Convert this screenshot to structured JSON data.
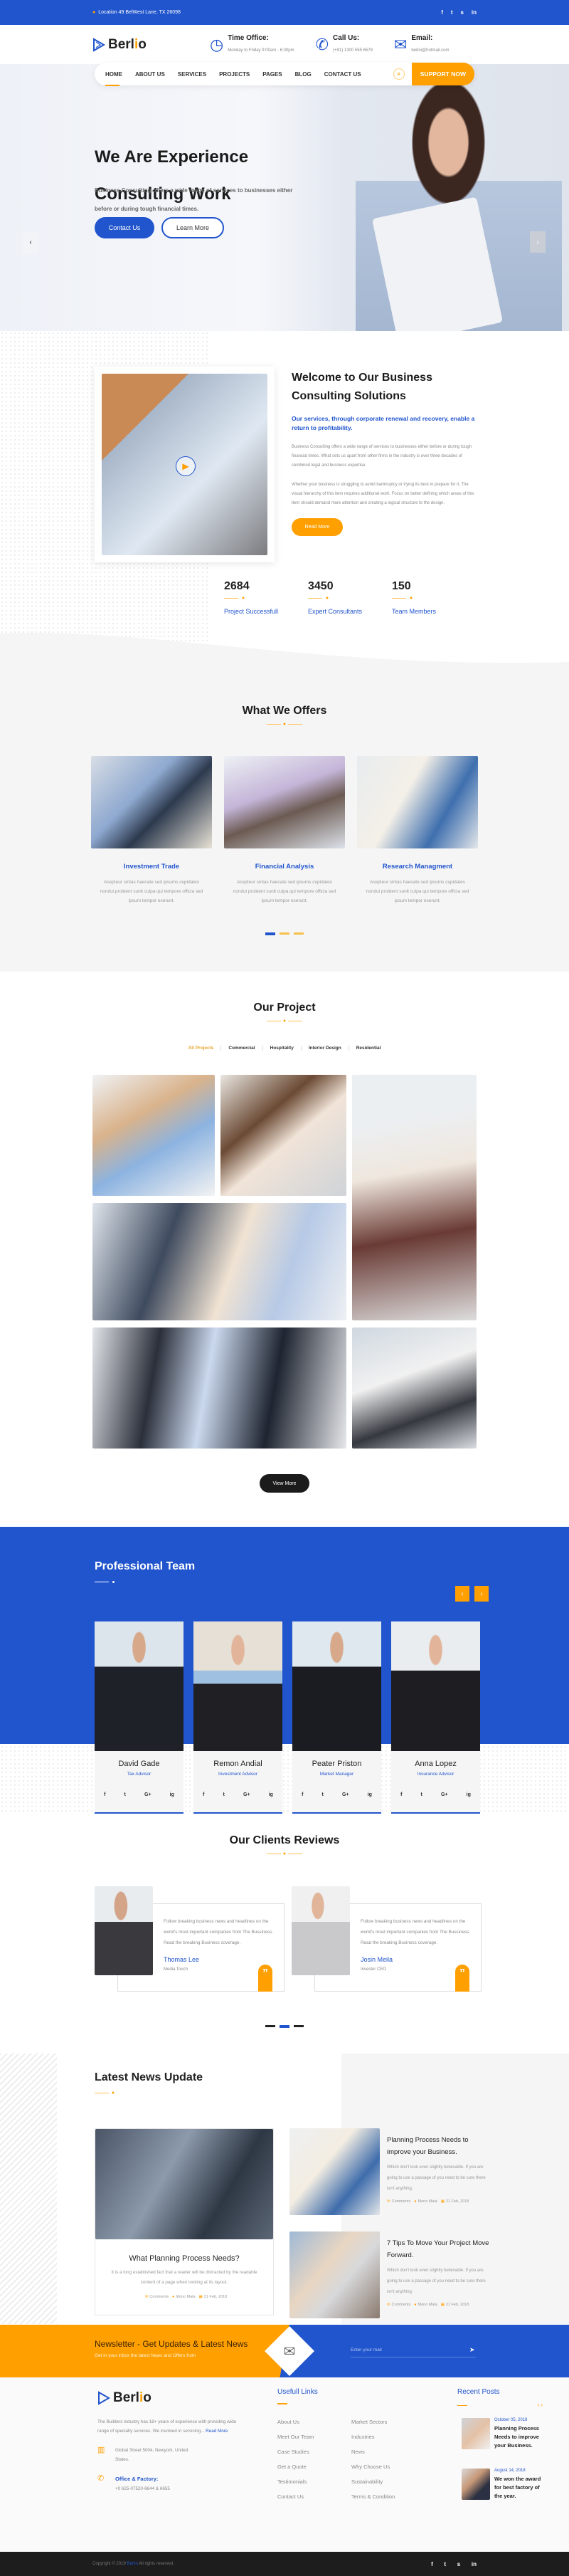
{
  "topbar": {
    "location": "Location 49 BelWest Lane, TX 26098",
    "social": [
      "f",
      "t",
      "s",
      "in"
    ]
  },
  "brand": {
    "name_a": "Berl",
    "name_i": "i",
    "name_b": "o"
  },
  "header": {
    "time": {
      "title": "Time Office:",
      "text": "Monday to Friday 9:00am - 6:00pm"
    },
    "call": {
      "title": "Call Us:",
      "text": "(+91) 1300 555 6578"
    },
    "email": {
      "title": "Email:",
      "text": "berlio@hotmail.com"
    }
  },
  "nav": {
    "items": [
      "HOME",
      "ABOUT US",
      "SERVICES",
      "PROJECTS",
      "PAGES",
      "BLOG",
      "CONTACT US"
    ],
    "active": "HOME",
    "support": "SUPPORT NOW"
  },
  "hero": {
    "title_line1": "We Are Experience",
    "title_line2": "Consulting Work",
    "text": "Business Consulting offers a wide range of services to businesses either before or during tough financial times.",
    "contact": "Contact Us",
    "learn": "Learn More"
  },
  "about": {
    "title": "Welcome to Our Business Consulting Solutions",
    "lead": "Our services, through corporate renewal and recovery, enable a return to profitability.",
    "p1": "Business Consulting offers a wide range of services to businesses either before or during tough financial times. What sets us apart from other firms in the industry is over three decades of combined legal and business expertise.",
    "p2": "Whether your business is struggling to avoid bankruptcy or trying its best to prepare for it, The visual hierarchy of this item requires additional work. Focus on better defining which areas of this item should demand more attention and creating a logical structure to the design.",
    "read_more": "Read More",
    "stats": [
      {
        "value": "2684",
        "label": "Project Successfull"
      },
      {
        "value": "3450",
        "label": "Expert Consultants"
      },
      {
        "value": "150",
        "label": "Team Members"
      }
    ]
  },
  "offers": {
    "title": "What We Offers",
    "items": [
      {
        "title": "Investment Trade",
        "text": "Acepteur sintas haecate sed ipsums cupidates nondui proident sunlt culpa qui tempore officia sed ipsum tempor eserunt."
      },
      {
        "title": "Financial Analysis",
        "text": "Acepteur sintas haecate sed ipsums cupidates nondui proident sunlt culpa qui tempore officia sed ipsum tempor eserunt."
      },
      {
        "title": "Research Managment",
        "text": "Acepteur sintas haecate sed ipsums cupidates nondui proident sunlt culpa qui tempore officia sed ipsum tempor eserunt."
      }
    ]
  },
  "project": {
    "title": "Our Project",
    "tabs": [
      "All Projects",
      "Commercial",
      "Hospitality",
      "Interior Design",
      "Residential"
    ],
    "active_tab": "All Projects",
    "view_more": "View More"
  },
  "team": {
    "title": "Professional Team",
    "members": [
      {
        "name": "David Gade",
        "role": "Tax Advisor"
      },
      {
        "name": "Remon Andial",
        "role": "Investment Advisor"
      },
      {
        "name": "Peater Priston",
        "role": "Market Manager"
      },
      {
        "name": "Anna Lopez",
        "role": "Insurance Advisor"
      }
    ],
    "social": [
      "f",
      "t",
      "G+",
      "ig"
    ]
  },
  "reviews": {
    "title": "Our Clients Reviews",
    "items": [
      {
        "text": "Follow breaking business news and headlines on the world's most important companies from The Bussiness. Read the breaking Business coverage.",
        "name": "Thomas Lee",
        "role": "Media Touch"
      },
      {
        "text": "Follow breaking business news and headlines on the world's most important companies from The Bussiness. Read the breaking Business coverage.",
        "name": "Josin Meila",
        "role": "Invester CEO"
      }
    ]
  },
  "news": {
    "title": "Latest News Update",
    "featured": {
      "title": "What Planning Process Needs?",
      "text": "It is a long established fact that a reader will be distracted by the readable content of a page when looking at its layout.",
      "comments": "Comments",
      "author": "Mono Mala",
      "date": "21 Feb, 2018"
    },
    "posts": [
      {
        "title": "Planning Process Needs to improve your Business.",
        "text": "Which don't look even slightly believable. If you are going to use a passage of you need to be sure there isn't anything.",
        "comments": "Comments",
        "author": "Mono Mala",
        "date": "21 Feb, 2018"
      },
      {
        "title": "7 Tips To Move Your Project Move Forward.",
        "text": "Which don't look even slightly believable. If you are going to use a passage of you need to be sure there isn't anything.",
        "comments": "Comments",
        "author": "Mono Mala",
        "date": "21 Feb, 2018"
      }
    ]
  },
  "newsletter": {
    "title": "Newsletter - Get Updates & Latest News",
    "subtitle": "Get in your inbox the latest News and Offers from",
    "placeholder": "Enter your mail"
  },
  "footer": {
    "about": "The Builders industry has 18+ years of experience with providing wide range of specialty services. We involved in servicing...",
    "read_more": "Read More",
    "address": "Global Street 5004, Newyork, United States.",
    "office_title": "Office & Factory:",
    "office_phone": "+0 625-07520-6644 & 6655",
    "links_title": "Usefull Links",
    "links": [
      "About Us",
      "Meet Our Team",
      "Case Studies",
      "Get a Quote",
      "Testimonials",
      "Contact Us",
      "Market Sectors",
      "Industries",
      "News",
      "Why Choose Us",
      "Sustainability",
      "Terms & Condition"
    ],
    "recent_title": "Recent Posts",
    "recent": [
      {
        "date": "October 05, 2018",
        "title": "Planning Process Needs to improve your Business."
      },
      {
        "date": "August 14, 2018",
        "title": "We won the award for best factory of the year."
      }
    ],
    "copyright_a": "Copyright © 2019",
    "copyright_brand": "Berlio",
    "copyright_b": "All rights reserved."
  },
  "colors": {
    "primary": "#2155cd",
    "accent": "#ff9f00"
  }
}
